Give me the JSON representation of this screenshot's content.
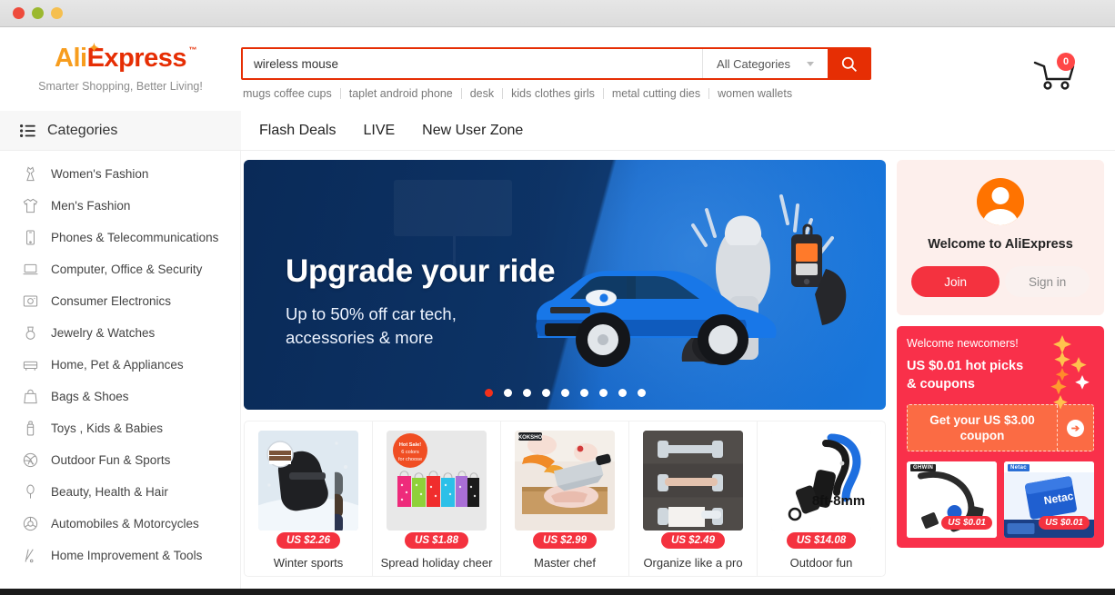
{
  "window": {
    "traffic_lights": [
      {
        "name": "close",
        "color": "#ee4b3c"
      },
      {
        "name": "minimize",
        "color": "#9bb82f"
      },
      {
        "name": "zoom",
        "color": "#f5bf4f"
      }
    ]
  },
  "header": {
    "logo": {
      "part1": "Ali",
      "part2": "Express",
      "tm": "™"
    },
    "tagline": "Smarter Shopping, Better Living!",
    "cart": {
      "count": "0",
      "icon": "shopping-cart-icon"
    }
  },
  "search": {
    "value": "wireless mouse",
    "placeholder": "wireless mouse",
    "category_label": "All Categories",
    "button_icon": "search-icon",
    "suggestions": [
      "mugs coffee cups",
      "taplet android phone",
      "desk",
      "kids clothes girls",
      "metal cutting dies",
      "women wallets"
    ]
  },
  "nav": {
    "categories_label": "Categories",
    "categories_icon": "list-menu-icon",
    "links": [
      "Flash Deals",
      "LIVE",
      "New User Zone"
    ]
  },
  "sidebar": {
    "items": [
      {
        "label": "Women's Fashion",
        "icon": "dress-icon"
      },
      {
        "label": "Men's Fashion",
        "icon": "tshirt-icon"
      },
      {
        "label": "Phones & Telecommunications",
        "icon": "phone-icon"
      },
      {
        "label": "Computer, Office & Security",
        "icon": "laptop-icon"
      },
      {
        "label": "Consumer Electronics",
        "icon": "camera-icon"
      },
      {
        "label": "Jewelry & Watches",
        "icon": "ring-icon"
      },
      {
        "label": "Home, Pet & Appliances",
        "icon": "sofa-icon"
      },
      {
        "label": "Bags & Shoes",
        "icon": "handbag-icon"
      },
      {
        "label": "Toys , Kids & Babies",
        "icon": "baby-bottle-icon"
      },
      {
        "label": "Outdoor Fun & Sports",
        "icon": "ball-icon"
      },
      {
        "label": "Beauty, Health & Hair",
        "icon": "mirror-icon"
      },
      {
        "label": "Automobiles & Motorcycles",
        "icon": "wheel-icon"
      },
      {
        "label": "Home Improvement & Tools",
        "icon": "paint-roller-icon"
      }
    ]
  },
  "hero": {
    "title": "Upgrade your ride",
    "subtitle": "Up to 50% off car tech,\naccessories & more",
    "subtitle_line1": "Up to 50% off car tech,",
    "subtitle_line2": "accessories & more",
    "dot_count": 9,
    "active_dot": 1,
    "active_dot_color": "#f4301a"
  },
  "products": [
    {
      "price": "US $2.26",
      "name": "Winter sports",
      "image": "winter-gloves"
    },
    {
      "price": "US $1.88",
      "name": "Spread holiday cheer",
      "image": "gift-bags",
      "badge": "Hot Sale! 6 colors for choose"
    },
    {
      "price": "US $2.99",
      "name": "Master chef",
      "image": "kitchen-knife"
    },
    {
      "price": "US $2.49",
      "name": "Organize like a pro",
      "image": "towel-rack"
    },
    {
      "price": "US $14.08",
      "name": "Outdoor fun",
      "image": "tow-strap",
      "overlay": "8ft-8mm"
    }
  ],
  "rail": {
    "welcome_title": "Welcome to AliExpress",
    "avatar_icon": "user-avatar-icon",
    "join_label": "Join",
    "signin_label": "Sign in",
    "promo": {
      "headline": "Welcome newcomers!",
      "subline": "US $0.01 hot picks & coupons",
      "coupon_label": "Get your US $3.00 coupon",
      "coupon_arrow_icon": "arrow-right-circle-icon",
      "tiles": [
        {
          "price": "US $0.01",
          "brand": "GHWIN",
          "image": "magnetic-usb-cable"
        },
        {
          "price": "US $0.01",
          "brand": "Netac",
          "image": "micro-sd-card"
        }
      ]
    }
  },
  "colors": {
    "brand_red": "#e62e04",
    "accent_red": "#f4323f",
    "promo_red": "#f9304a",
    "coupon_orange": "#fb6b44",
    "avatar_orange": "#ff7300",
    "hero_blue_dark": "#0f3a74",
    "hero_blue_light": "#1877dd"
  }
}
